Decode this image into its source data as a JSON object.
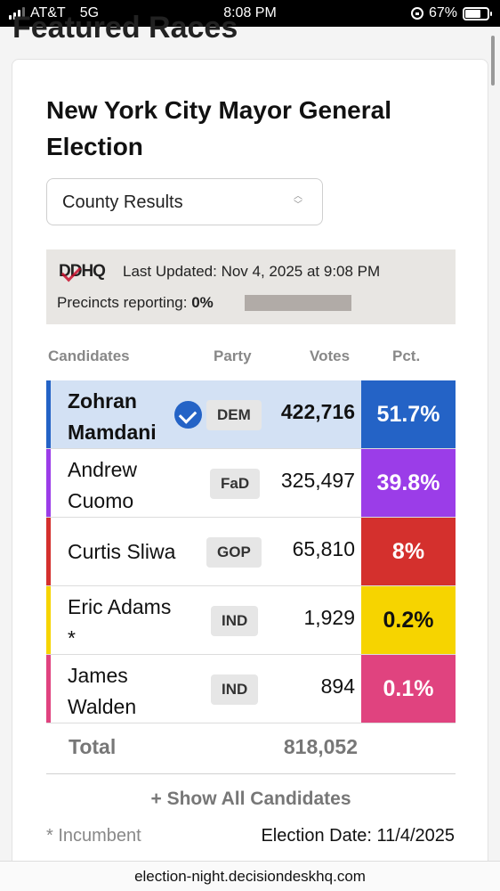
{
  "status_bar": {
    "carrier": "AT&T",
    "network": "5G",
    "time": "8:08 PM",
    "battery": "67%"
  },
  "page": {
    "section_heading": "Featured Races"
  },
  "race": {
    "title": "New York City Mayor General Election",
    "results_select": {
      "selected": "County Results"
    },
    "update_box": {
      "logo_text": "DDHQ",
      "last_updated": "Last Updated: Nov 4, 2025 at 9:08 PM",
      "precincts_label": "Precincts reporting:",
      "precincts_value": "0%",
      "precincts_fraction": 0
    },
    "table": {
      "headers": {
        "candidates": "Candidates",
        "party": "Party",
        "votes": "Votes",
        "pct": "Pct."
      },
      "rows": [
        {
          "name": "Zohran Mamdani",
          "party": "DEM",
          "votes": "422,716",
          "pct": "51.7%",
          "color": "#2463c6",
          "winner": true
        },
        {
          "name": "Andrew Cuomo",
          "party": "FaD",
          "votes": "325,497",
          "pct": "39.8%",
          "color": "#9b3de8",
          "winner": false
        },
        {
          "name": "Curtis Sliwa",
          "party": "GOP",
          "votes": "65,810",
          "pct": "8%",
          "color": "#d4302d",
          "winner": false
        },
        {
          "name": "Eric Adams *",
          "party": "IND",
          "votes": "1,929",
          "pct": "0.2%",
          "color": "#f6d400",
          "winner": false
        },
        {
          "name": "James Walden",
          "party": "IND",
          "votes": "894",
          "pct": "0.1%",
          "color": "#e0437f",
          "winner": false
        }
      ],
      "total_label": "Total",
      "total_votes": "818,052"
    },
    "show_all_label": "+ Show All Candidates",
    "incumbent_note": "* Incumbent",
    "election_date": "Election Date: 11/4/2025"
  },
  "browser": {
    "url": "election-night.decisiondeskhq.com"
  },
  "icons": [
    "signal-icon",
    "lock-rotation-icon",
    "battery-icon",
    "chevron-updown-icon",
    "winner-check-icon"
  ]
}
